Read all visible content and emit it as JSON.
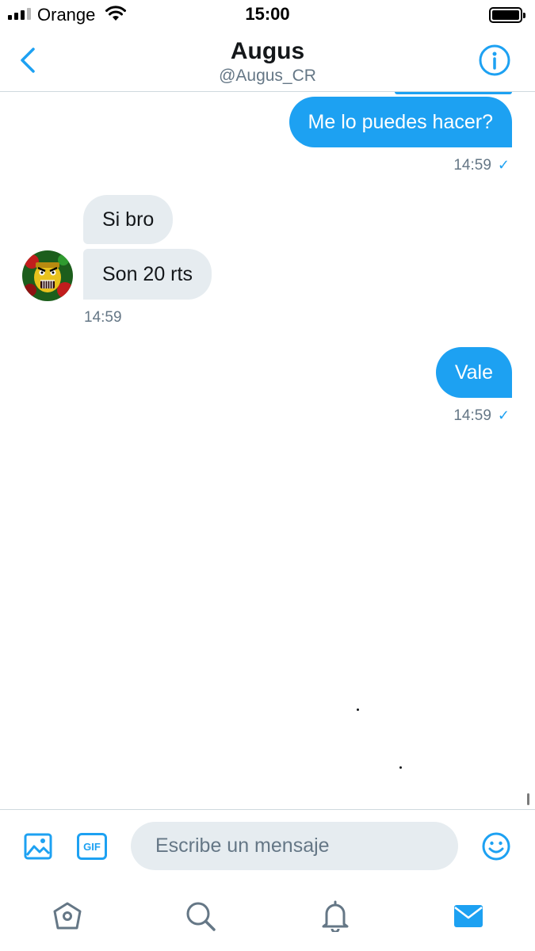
{
  "status_bar": {
    "carrier": "Orange",
    "time": "15:00"
  },
  "header": {
    "title": "Augus",
    "handle": "@Augus_CR"
  },
  "messages": [
    {
      "direction": "sent",
      "text": "Me lo puedes hacer?",
      "time": "14:59",
      "check": "✓"
    },
    {
      "direction": "received",
      "text": "Si bro"
    },
    {
      "direction": "received",
      "text": "Son 20 rts",
      "time": "14:59"
    },
    {
      "direction": "sent",
      "text": "Vale",
      "time": "14:59",
      "check": "✓"
    }
  ],
  "composer": {
    "placeholder": "Escribe un mensaje",
    "gif_label": "GIF"
  },
  "icons": {
    "back": "chevron-left-icon",
    "info": "info-icon",
    "media": "image-icon",
    "emoji": "smiley-icon",
    "home": "home-icon",
    "search": "search-icon",
    "notifications": "bell-icon",
    "messages": "envelope-icon"
  },
  "colors": {
    "accent": "#1da1f2",
    "received_bubble": "#e6ecf0",
    "secondary_text": "#657786",
    "inactive_icon": "#657786"
  }
}
